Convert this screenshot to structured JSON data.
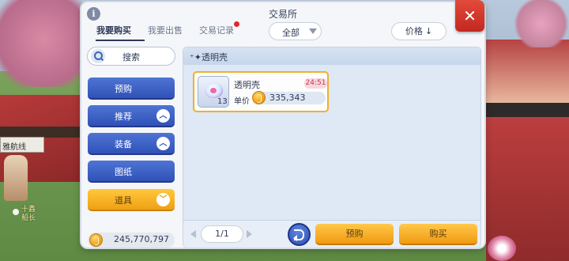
{
  "window": {
    "title": "交易所"
  },
  "tabs": [
    {
      "label": "我要购买",
      "active": true
    },
    {
      "label": "我要出售",
      "active": false
    },
    {
      "label": "交易记录",
      "active": false,
      "has_notification": true
    }
  ],
  "filter": {
    "selected": "全部"
  },
  "sort": {
    "label": "价格",
    "arrow": "↓"
  },
  "sidebar": {
    "search_label": "搜索",
    "categories": [
      {
        "label": "预购",
        "toggle": ""
      },
      {
        "label": "推荐",
        "toggle": "^"
      },
      {
        "label": "装备",
        "toggle": "^"
      },
      {
        "label": "图纸",
        "toggle": ""
      },
      {
        "label": "道具",
        "toggle": "v",
        "active": true
      }
    ],
    "currency_amount": "245,770,797"
  },
  "content": {
    "header": "⁺✦透明壳",
    "listings": [
      {
        "name": "透明壳",
        "quantity": "13",
        "timer": "24:51",
        "price_label": "单价",
        "price": "335,343"
      }
    ]
  },
  "footer": {
    "page": "1/1",
    "preorder_label": "预购",
    "buy_label": "购买"
  },
  "background": {
    "npc_tag": "雅航线",
    "npc_name_line1": "十鑫",
    "npc_name_line2": "船长"
  },
  "colors": {
    "accent_blue": "#3052b8",
    "accent_orange": "#f0a015",
    "close_red": "#d1342b",
    "timer_red": "#cc3a4b"
  },
  "icons": {
    "info": "info-icon",
    "close": "close-icon",
    "search": "search-icon",
    "coin": "zeny-coin-icon",
    "refresh": "refresh-icon"
  }
}
